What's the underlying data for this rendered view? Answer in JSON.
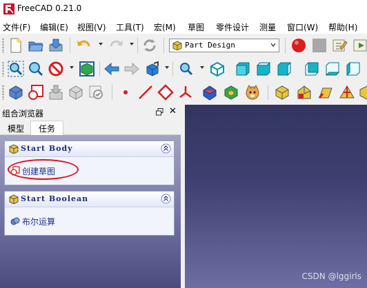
{
  "window": {
    "title": "FreeCAD 0.21.0"
  },
  "menu": {
    "items": [
      "文件(F)",
      "编辑(E)",
      "视图(V)",
      "工具(T)",
      "宏(M)",
      "草图",
      "零件设计",
      "测量",
      "窗口(W)",
      "帮助(H)"
    ]
  },
  "toolbar": {
    "workbench": "Part Design",
    "colors": {
      "record": "#d81e1e",
      "cube": "#19b3c8",
      "arrow": "#2a7fd4"
    }
  },
  "combo_view": {
    "title": "组合浏览器",
    "tabs": [
      "模型",
      "任务"
    ],
    "active_tab": "任务",
    "panels": [
      {
        "title": "Start Body",
        "action": "创建草图",
        "highlighted": true
      },
      {
        "title": "Start Boolean",
        "action": "布尔运算",
        "highlighted": false
      }
    ]
  },
  "watermark": "CSDN @lggirls"
}
